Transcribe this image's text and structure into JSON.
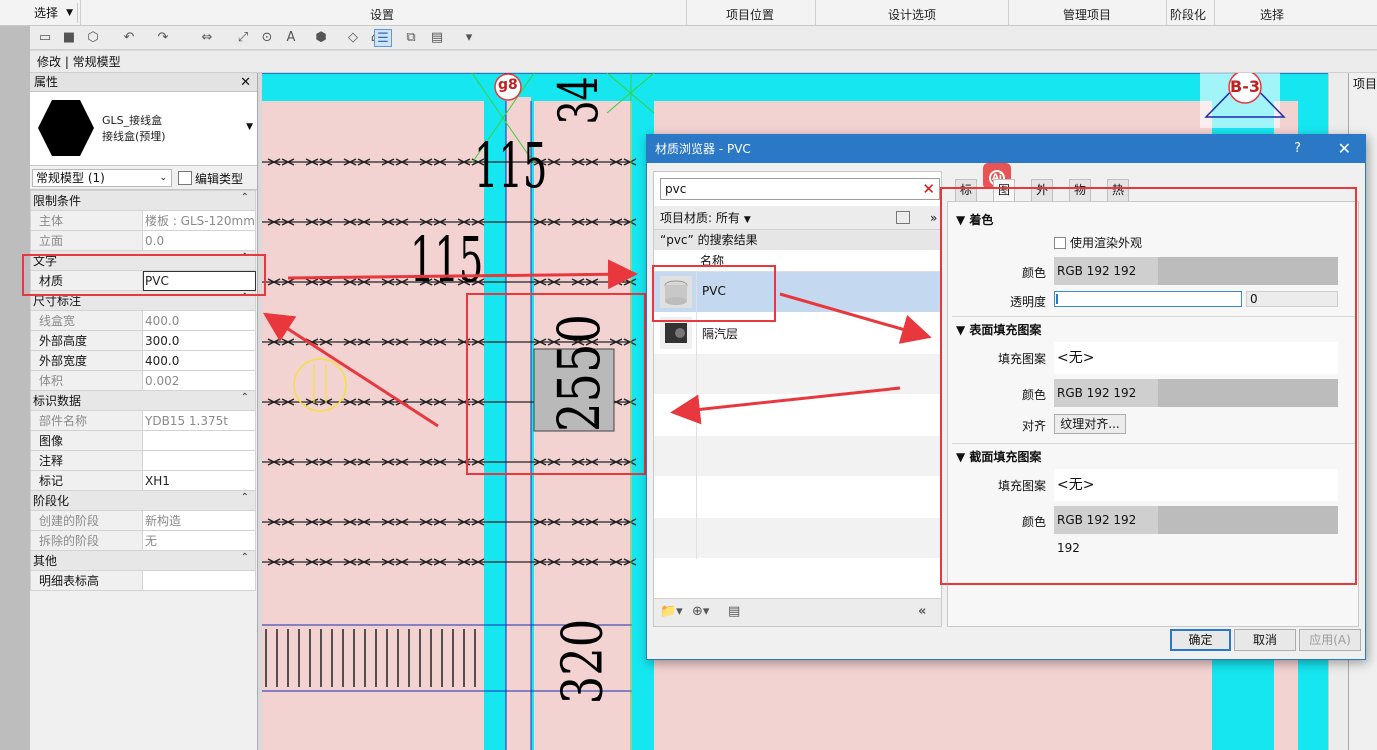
{
  "ribbon": {
    "select_label": "选择",
    "groups": [
      "设置",
      "项目位置",
      "设计选项",
      "管理项目",
      "阶段化",
      "选择"
    ]
  },
  "context_bar": {
    "text": "修改 | 常规模型"
  },
  "properties": {
    "title": "属性",
    "family_name": "GLS_接线盒",
    "type_name": "接线盒(预埋)",
    "type_selector": "常规模型 (1)",
    "edit_type_label": "编辑类型",
    "sections": [
      {
        "name": "限制条件",
        "rows": [
          {
            "label": "主体",
            "value": "楼板 : GLS-120mm",
            "dim": true
          },
          {
            "label": "立面",
            "value": "0.0",
            "dim": true
          }
        ]
      },
      {
        "name": "文字",
        "rows": [
          {
            "label": "材质",
            "value": "PVC",
            "dim": false
          }
        ]
      },
      {
        "name": "尺寸标注",
        "rows": [
          {
            "label": "线盒宽",
            "value": "400.0",
            "dim": true
          },
          {
            "label": "外部高度",
            "value": "300.0",
            "dim": false
          },
          {
            "label": "外部宽度",
            "value": "400.0",
            "dim": false
          },
          {
            "label": "体积",
            "value": "0.002",
            "dim": true
          }
        ]
      },
      {
        "name": "标识数据",
        "rows": [
          {
            "label": "部件名称",
            "value": "YDB15 1.375t",
            "dim": true
          },
          {
            "label": "图像",
            "value": "",
            "dim": false
          },
          {
            "label": "注释",
            "value": "",
            "dim": false
          },
          {
            "label": "标记",
            "value": "XH1",
            "dim": false
          }
        ]
      },
      {
        "name": "阶段化",
        "rows": [
          {
            "label": "创建的阶段",
            "value": "新构造",
            "dim": true
          },
          {
            "label": "拆除的阶段",
            "value": "无",
            "dim": true
          }
        ]
      },
      {
        "name": "其他",
        "rows": [
          {
            "label": "明细表标高",
            "value": "",
            "dim": false
          }
        ]
      }
    ]
  },
  "canvas": {
    "tag_g8": "g8",
    "tag_b3": "B-3",
    "dim_115_a": "115",
    "dim_115_b": "115",
    "dim_2550": "2550",
    "dim_320": "320",
    "dim_top": "34"
  },
  "right_pane": {
    "title": "项目"
  },
  "material_browser": {
    "title": "材质浏览器 - PVC",
    "help": "?",
    "search_value": "pvc",
    "library_filter": "项目材质: 所有",
    "results_header": "“pvc” 的搜索结果",
    "column_name": "名称",
    "materials": [
      {
        "name": "PVC",
        "selected": true
      },
      {
        "name": "隔汽层",
        "selected": false
      }
    ],
    "tabs": [
      "标识",
      "图形",
      "外观",
      "物理",
      "热度"
    ],
    "active_tab": "图形",
    "ai_badge": "Ai",
    "graphics": {
      "shading_header": "着色",
      "use_render_appearance": "使用渲染外观",
      "color_label": "颜色",
      "color_value": "RGB 192 192 192",
      "transparency_label": "透明度",
      "transparency_value": "0",
      "surface_header": "表面填充图案",
      "fill_pattern_label": "填充图案",
      "surface_fill_value": "<无>",
      "surface_color_value": "RGB 192 192 192",
      "align_label": "对齐",
      "align_button": "纹理对齐...",
      "cut_header": "截面填充图案",
      "cut_fill_value": "<无>",
      "cut_color_value": "RGB 192 192 192"
    },
    "buttons": {
      "ok": "确定",
      "cancel": "取消",
      "apply": "应用(A)"
    }
  },
  "colors": {
    "accent": "#2b78c6",
    "annotation_red": "#e8383d",
    "canvas_pink": "#f3d2d2",
    "canvas_cyan": "#16e6f0"
  }
}
